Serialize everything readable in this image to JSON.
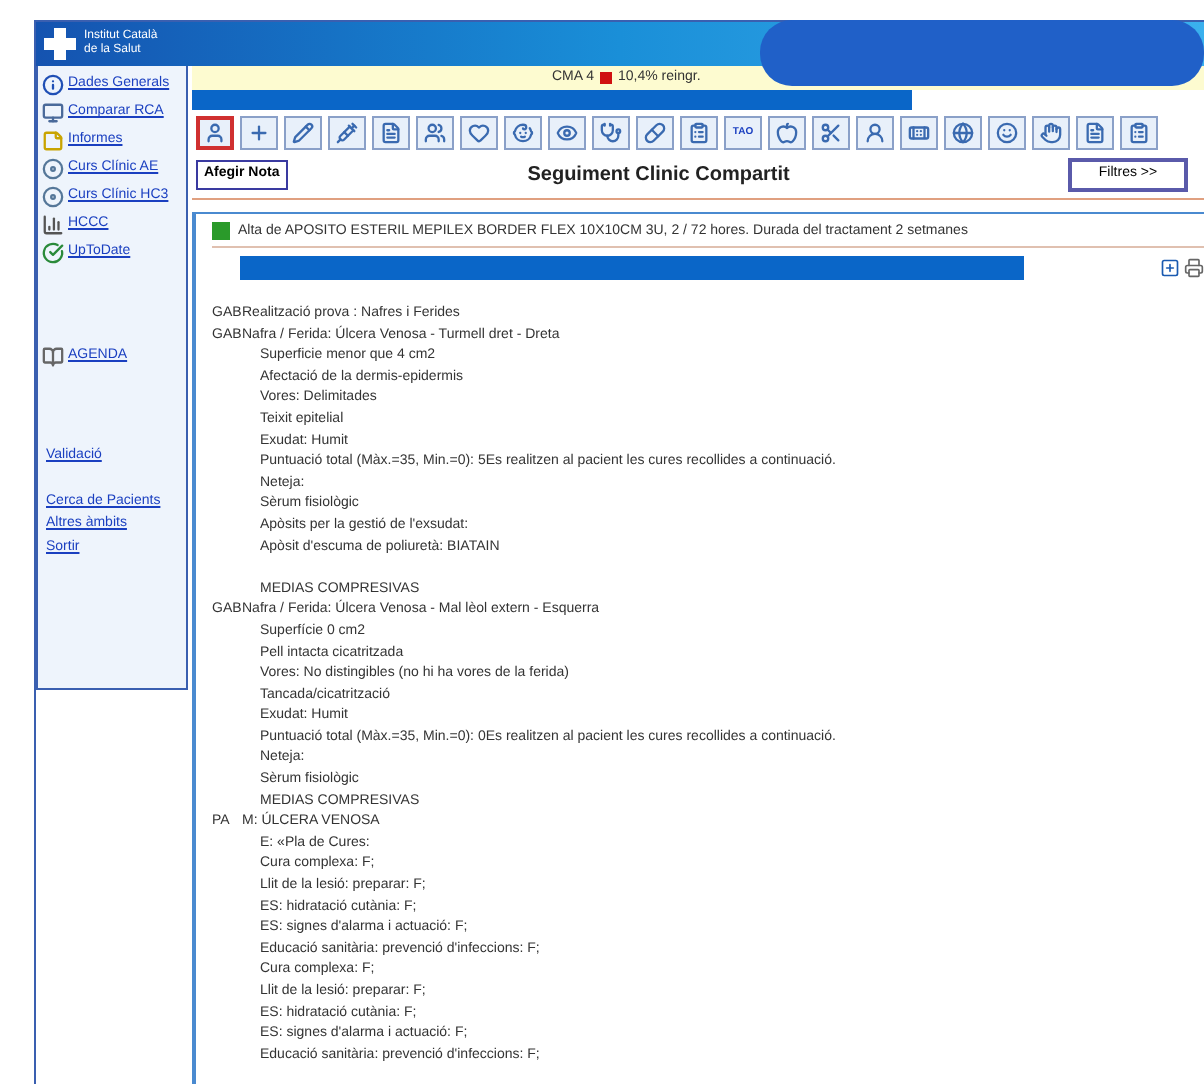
{
  "header": {
    "logo_text": "Institut Català de la Salut"
  },
  "sidebar": {
    "items": [
      {
        "label": "Dades Generals"
      },
      {
        "label": "Comparar RCA"
      },
      {
        "label": "Informes"
      },
      {
        "label": "Curs Clínic AE"
      },
      {
        "label": "Curs Clínic HC3"
      },
      {
        "label": "HCCC"
      },
      {
        "label": "UpToDate"
      },
      {
        "label": "AGENDA"
      }
    ],
    "link_groups": [
      [
        "Validació"
      ],
      [
        "Cerca de Pacients",
        "Altres àmbits",
        "Sortir"
      ]
    ]
  },
  "info_bar": {
    "text": "CMA 4",
    "reading": "10,4% reingr."
  },
  "toolbar": [
    {
      "selected": true
    },
    {
      "selected": false
    },
    {
      "selected": false
    },
    {
      "selected": false
    },
    {
      "selected": false
    },
    {
      "selected": false
    },
    {
      "selected": false
    },
    {
      "selected": false
    },
    {
      "selected": false
    },
    {
      "selected": false
    },
    {
      "selected": false
    },
    {
      "selected": false
    },
    {
      "selected": false,
      "label": "TAO"
    },
    {
      "selected": false
    },
    {
      "selected": false
    },
    {
      "selected": false
    },
    {
      "selected": false
    },
    {
      "selected": false
    },
    {
      "selected": false
    },
    {
      "selected": false
    },
    {
      "selected": false
    },
    {
      "selected": false
    }
  ],
  "actions": {
    "add_note": "Afegir Nota",
    "title": "Seguiment Clinic Compartit",
    "filters": "Filtres >>"
  },
  "entry": {
    "title": "Alta de APOSITO ESTERIL MEPILEX BORDER FLEX 10X10CM 3U, 2 / 72 hores. Durada del tractament 2 setmanes"
  },
  "notes": [
    {
      "tag": "GAB",
      "text": "Realització prova : Nafres i Ferides"
    },
    {
      "tag": "GAB",
      "text": "Nafra / Ferida: Úlcera Venosa - Turmell dret - Dreta",
      "blocks": [
        [
          "Superficie menor que 4 cm2",
          "Afectació de la dermis-epidermis",
          "Vores: Delimitades",
          "Teixit epitelial",
          "Exudat: Humit",
          "Puntuació total (Màx.=35, Min.=0): 5Es realitzen al pacient les cures recollides a continuació.",
          "Neteja:",
          "Sèrum fisiològic",
          "Apòsits per la gestió de l'exsudat:",
          "Apòsit d'escuma de poliuretà: BIATAIN"
        ],
        [
          "MEDIAS COMPRESIVAS"
        ]
      ]
    },
    {
      "tag": "GAB",
      "text": "Nafra / Ferida: Úlcera Venosa - Mal lèol extern - Esquerra",
      "blocks": [
        [
          "Superfície 0 cm2",
          "Pell intacta cicatritzada",
          "Vores: No distingibles (no hi ha vores de la ferida)",
          "Tancada/cicatrització",
          "Exudat: Humit",
          "Puntuació total (Màx.=35, Min.=0): 0Es realitzen al pacient les cures recollides a continuació.",
          "Neteja:",
          "Sèrum fisiològic",
          "MEDIAS COMPRESIVAS"
        ]
      ]
    },
    {
      "tag": "PA",
      "text": "M: ÚLCERA VENOSA",
      "blocks": [
        [
          "E: «Pla de Cures:",
          "Cura complexa: F;",
          "Llit de la lesió: preparar: F;",
          "ES: hidratació cutània: F;",
          "ES: signes d'alarma i actuació: F;",
          "Educació sanitària: prevenció d'infeccions: F;",
          "Cura complexa: F;",
          "Llit de la lesió: preparar: F;",
          "ES: hidratació cutània: F;",
          "ES: signes d'alarma i actuació: F;",
          "Educació sanitària: prevenció d'infeccions: F;"
        ]
      ]
    }
  ]
}
